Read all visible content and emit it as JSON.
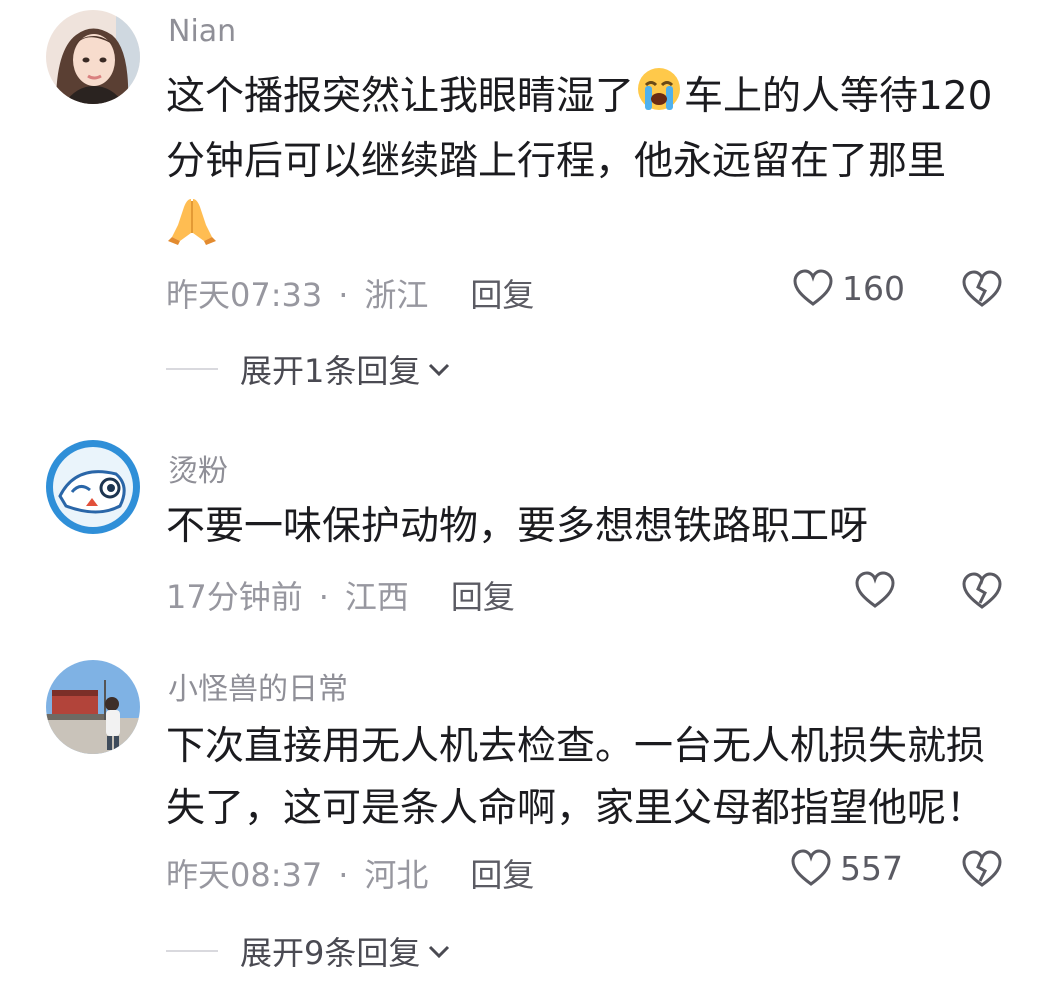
{
  "comments": [
    {
      "author": "Nian",
      "text_lines": [
        "这个播报突然让我眼睛湿了",
        "车上的人等待120",
        "分钟后可以继续踏上行程，他永远留在了那里"
      ],
      "time": "昨天07:33",
      "location": "浙江",
      "reply_label": "回复",
      "likes": "160",
      "expand_label": "展开1条回复",
      "avatar": "woman-avatar"
    },
    {
      "author": "烫粉",
      "text_lines": [
        "不要一味保护动物，要多想想铁路职工呀"
      ],
      "time": "17分钟前",
      "location": "江西",
      "reply_label": "回复",
      "likes": "",
      "avatar": "cartoon-avatar"
    },
    {
      "author": "小怪兽的日常",
      "text_lines": [
        "下次直接用无人机去检查。一台无人机损失就损",
        "失了，这可是条人命啊，家里父母都指望他呢！"
      ],
      "time": "昨天08:37",
      "location": "河北",
      "reply_label": "回复",
      "likes": "557",
      "expand_label": "展开9条回复",
      "avatar": "photo-avatar"
    }
  ],
  "icons": {
    "like": "heart-outline-icon",
    "dislike": "broken-heart-icon",
    "crying": "crying-face-emoji",
    "pray": "folded-hands-emoji",
    "expand": "chevron-down-icon"
  },
  "colors": {
    "text": "#1b1b1f",
    "meta": "#97979f",
    "author": "#8f8f97"
  }
}
